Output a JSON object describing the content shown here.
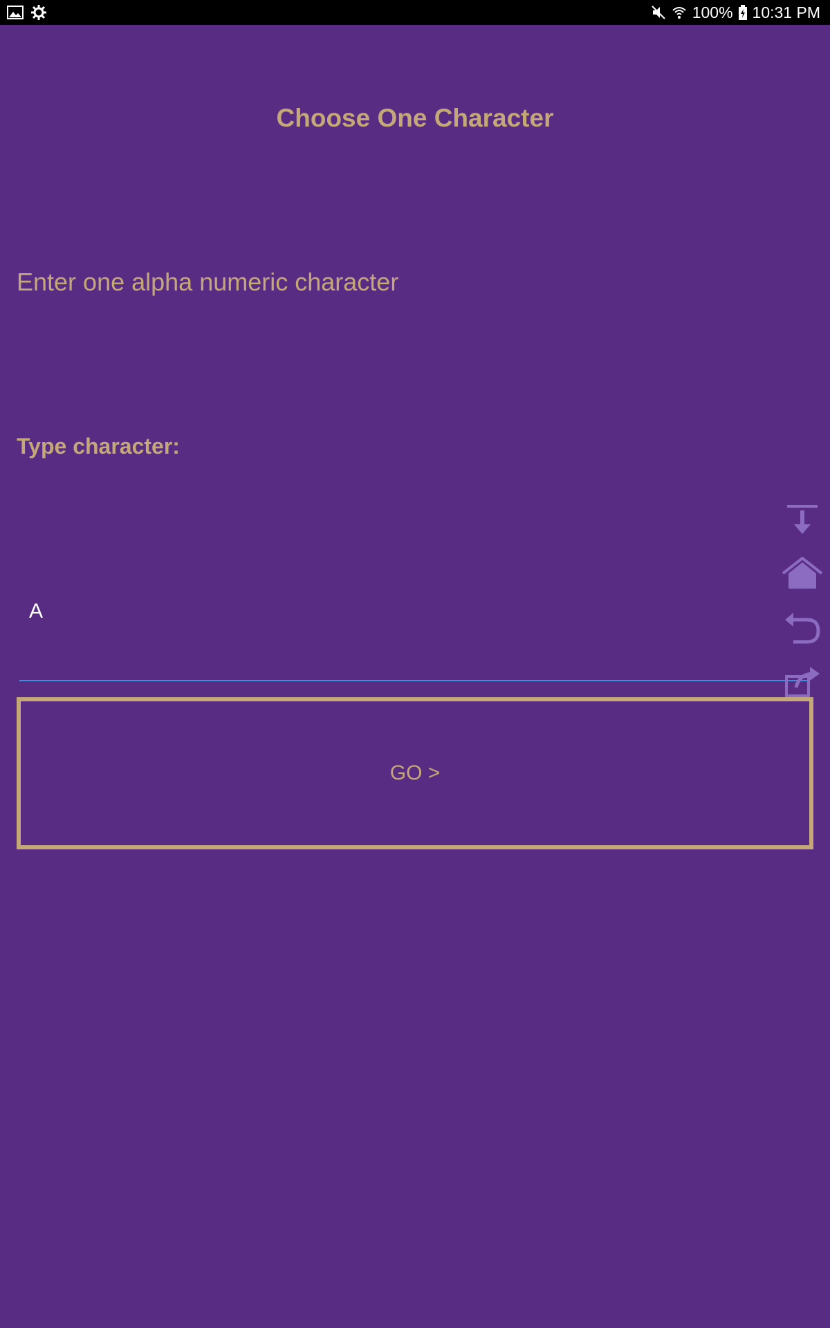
{
  "status_bar": {
    "left_icons": [
      "image-icon",
      "settings-gear-icon"
    ],
    "right_icons": [
      "mute-icon",
      "wifi-icon",
      "battery-charging-icon"
    ],
    "battery": "100%",
    "time": "10:31 PM"
  },
  "screen": {
    "title": "Choose One Character",
    "prompt": "Enter one alpha numeric character",
    "type_label": "Type character:",
    "input_value": "A",
    "go_label": "GO >"
  },
  "floating_toolbar": {
    "icons": [
      "download-icon",
      "home-icon",
      "undo-icon",
      "share-icon"
    ]
  },
  "colors": {
    "background": "#582c83",
    "accent": "#c5a878",
    "input_underline": "#3d8de0",
    "status_bar": "#000000"
  }
}
